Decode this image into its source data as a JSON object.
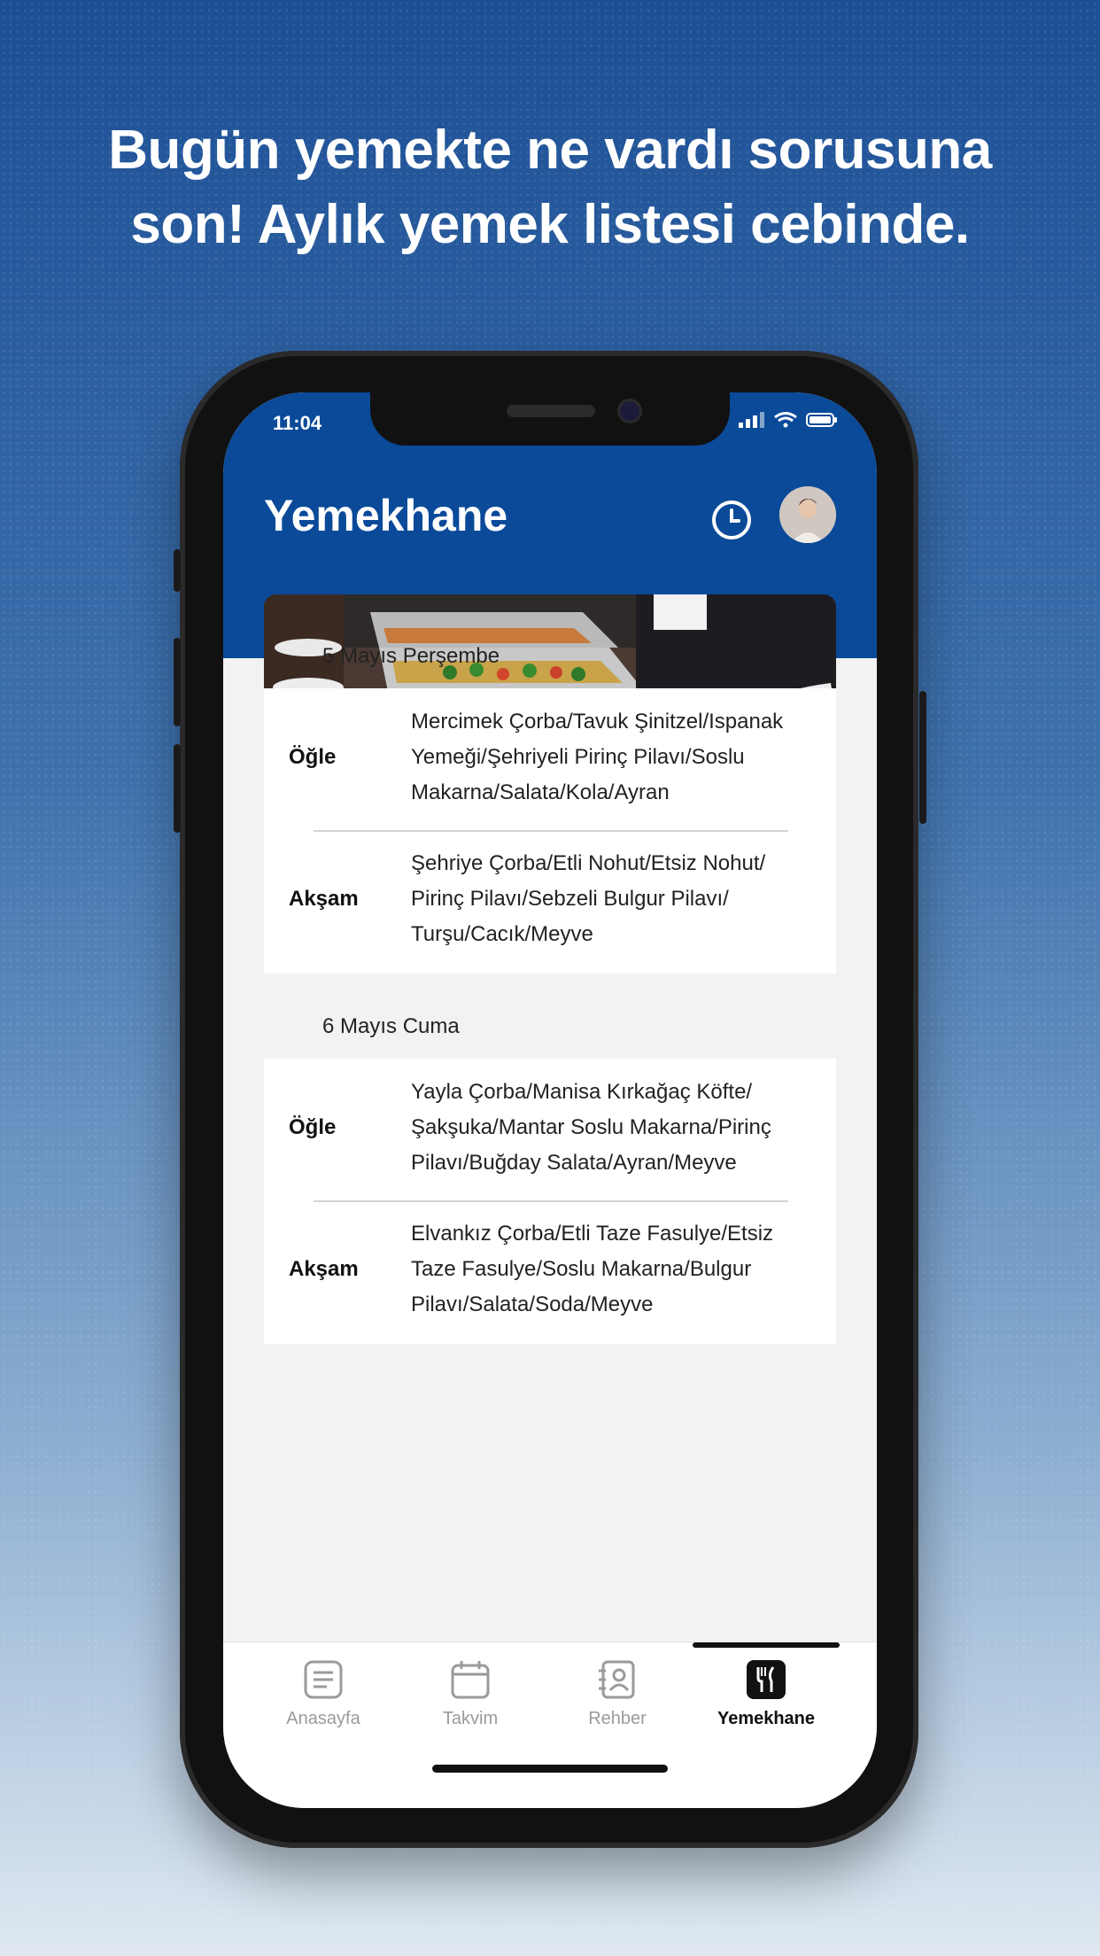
{
  "promo": {
    "headline_line1": "Bugün yemekte ne vardı sorusuna",
    "headline_line2": "son! Aylık yemek listesi cebinde."
  },
  "status_bar": {
    "time": "11:04"
  },
  "header": {
    "title": "Yemekhane",
    "history_icon": "clock-icon",
    "avatar_icon": "user-avatar"
  },
  "days": [
    {
      "date": "5 Mayıs Perşembe",
      "meals": [
        {
          "name": "Öğle",
          "lines": [
            "Mercimek Çorba/Tavuk Şinitzel/Ispanak",
            "Yemeği/Şehriyeli Pirinç Pilavı/Soslu",
            "Makarna/Salata/Kola/Ayran"
          ]
        },
        {
          "name": "Akşam",
          "lines": [
            "Şehriye Çorba/Etli Nohut/Etsiz Nohut/",
            "Pirinç Pilavı/Sebzeli Bulgur Pilavı/",
            "Turşu/Cacık/Meyve"
          ]
        }
      ]
    },
    {
      "date": "6 Mayıs Cuma",
      "meals": [
        {
          "name": "Öğle",
          "lines": [
            "Yayla Çorba/Manisa Kırkağaç Köfte/",
            "Şakşuka/Mantar Soslu Makarna/Pirinç",
            "Pilavı/Buğday Salata/Ayran/Meyve"
          ]
        },
        {
          "name": "Akşam",
          "lines": [
            "Elvankız Çorba/Etli Taze Fasulye/Etsiz",
            "Taze Fasulye/Soslu Makarna/Bulgur",
            "Pilavı/Salata/Soda/Meyve"
          ]
        }
      ]
    }
  ],
  "tabs": [
    {
      "label": "Anasayfa",
      "icon": "document-icon"
    },
    {
      "label": "Takvim",
      "icon": "calendar-icon"
    },
    {
      "label": "Rehber",
      "icon": "contacts-icon"
    },
    {
      "label": "Yemekhane",
      "icon": "cutlery-icon",
      "active": true
    }
  ],
  "colors": {
    "brand_blue": "#0a4a99",
    "background": "#f2f2f2"
  }
}
